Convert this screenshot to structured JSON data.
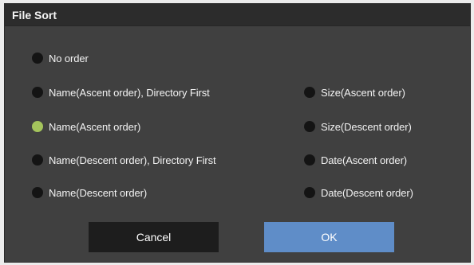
{
  "dialog": {
    "title": "File Sort",
    "options_left": [
      {
        "label": "No order",
        "selected": false
      },
      {
        "label": "Name(Ascent order), Directory First",
        "selected": false
      },
      {
        "label": "Name(Ascent order)",
        "selected": true
      },
      {
        "label": "Name(Descent order), Directory First",
        "selected": false
      },
      {
        "label": "Name(Descent order)",
        "selected": false
      }
    ],
    "options_right": [
      {
        "label": "Size(Ascent order)",
        "selected": false
      },
      {
        "label": "Size(Descent order)",
        "selected": false
      },
      {
        "label": "Date(Ascent order)",
        "selected": false
      },
      {
        "label": "Date(Descent order)",
        "selected": false
      }
    ],
    "buttons": {
      "cancel_label": "Cancel",
      "ok_label": "OK"
    }
  },
  "colors": {
    "dialog_background": "#404040",
    "titlebar_background": "#2c2c2c",
    "radio_unselected": "#141414",
    "radio_selected": "#a4c45c",
    "cancel_button": "#1d1d1d",
    "ok_button": "#5f8dc8"
  }
}
